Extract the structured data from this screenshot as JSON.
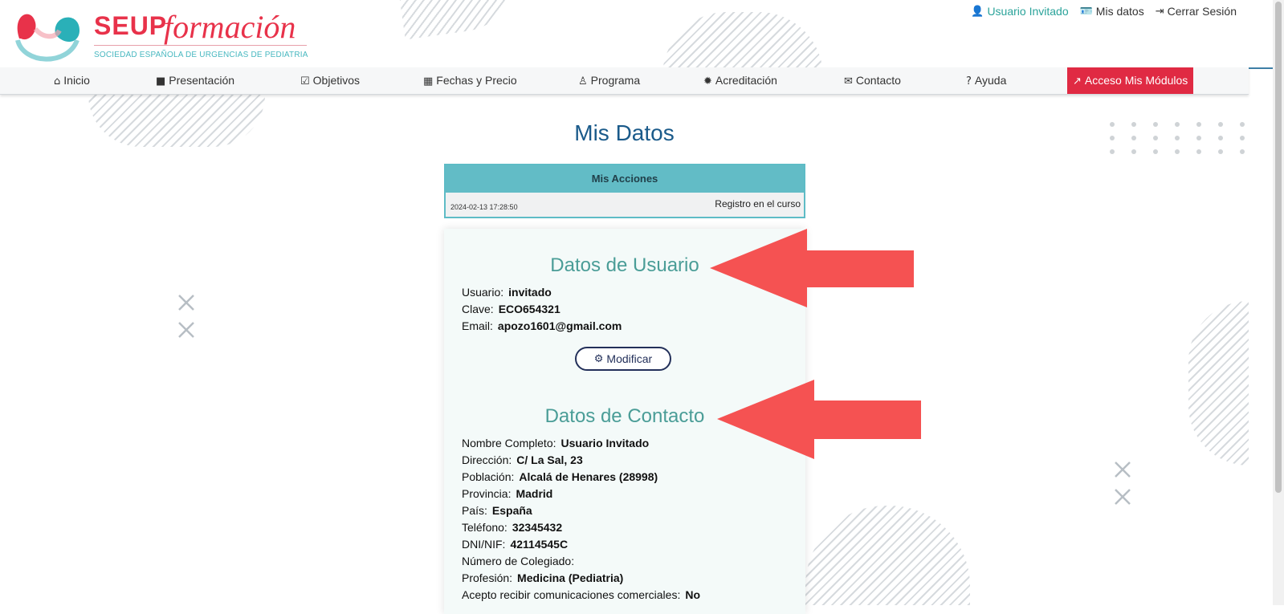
{
  "brand": {
    "name_bold": "SEUP",
    "name_script": "formación",
    "tagline": "SOCIEDAD ESPAÑOLA DE URGENCIAS DE PEDIATRIA",
    "accent_color": "#e8324a",
    "secondary_color": "#48b8c0"
  },
  "user_links": {
    "user": "Usuario Invitado",
    "my_data": "Mis datos",
    "logout": "Cerrar Sesión"
  },
  "nav": {
    "items": [
      {
        "label": "Inicio",
        "icon": "home-icon"
      },
      {
        "label": "Presentación",
        "icon": "video-icon"
      },
      {
        "label": "Objetivos",
        "icon": "checkbox-icon"
      },
      {
        "label": "Fechas y Precio",
        "icon": "calendar-icon"
      },
      {
        "label": "Programa",
        "icon": "user-doctor-icon"
      },
      {
        "label": "Acreditación",
        "icon": "certificate-icon"
      },
      {
        "label": "Contacto",
        "icon": "envelope-icon"
      },
      {
        "label": "Ayuda",
        "icon": "question-icon"
      }
    ],
    "cta": {
      "label": "Acceso Mis Módulos",
      "icon": "external-link-icon",
      "color": "#e02a43"
    }
  },
  "page": {
    "title": "Mis Datos"
  },
  "actions": {
    "header": "Mis Acciones",
    "rows": [
      {
        "date": "2024-02-13 17:28:50",
        "action": "Registro en el curso"
      }
    ]
  },
  "user_data": {
    "title": "Datos de Usuario",
    "fields": [
      {
        "label": "Usuario:",
        "value": "invitado"
      },
      {
        "label": "Clave:",
        "value": "ECO654321"
      },
      {
        "label": "Email:",
        "value": "apozo1601@gmail.com"
      }
    ],
    "modify_label": "Modificar"
  },
  "contact_data": {
    "title": "Datos de Contacto",
    "fields": [
      {
        "label": "Nombre Completo:",
        "value": "Usuario Invitado"
      },
      {
        "label": "Dirección:",
        "value": "C/ La Sal, 23"
      },
      {
        "label": "Población:",
        "value": "Alcalá de Henares (28998)"
      },
      {
        "label": "Provincia:",
        "value": "Madrid"
      },
      {
        "label": "País:",
        "value": "España"
      },
      {
        "label": "Teléfono:",
        "value": "32345432"
      },
      {
        "label": "DNI/NIF:",
        "value": "42114545C"
      },
      {
        "label": "Número de Colegiado:",
        "value": ""
      },
      {
        "label": "Profesión:",
        "value": "Medicina (Pediatria)"
      },
      {
        "label": "Acepto recibir comunicaciones comerciales:",
        "value": "No"
      }
    ]
  },
  "annotation_color": "#f55252"
}
